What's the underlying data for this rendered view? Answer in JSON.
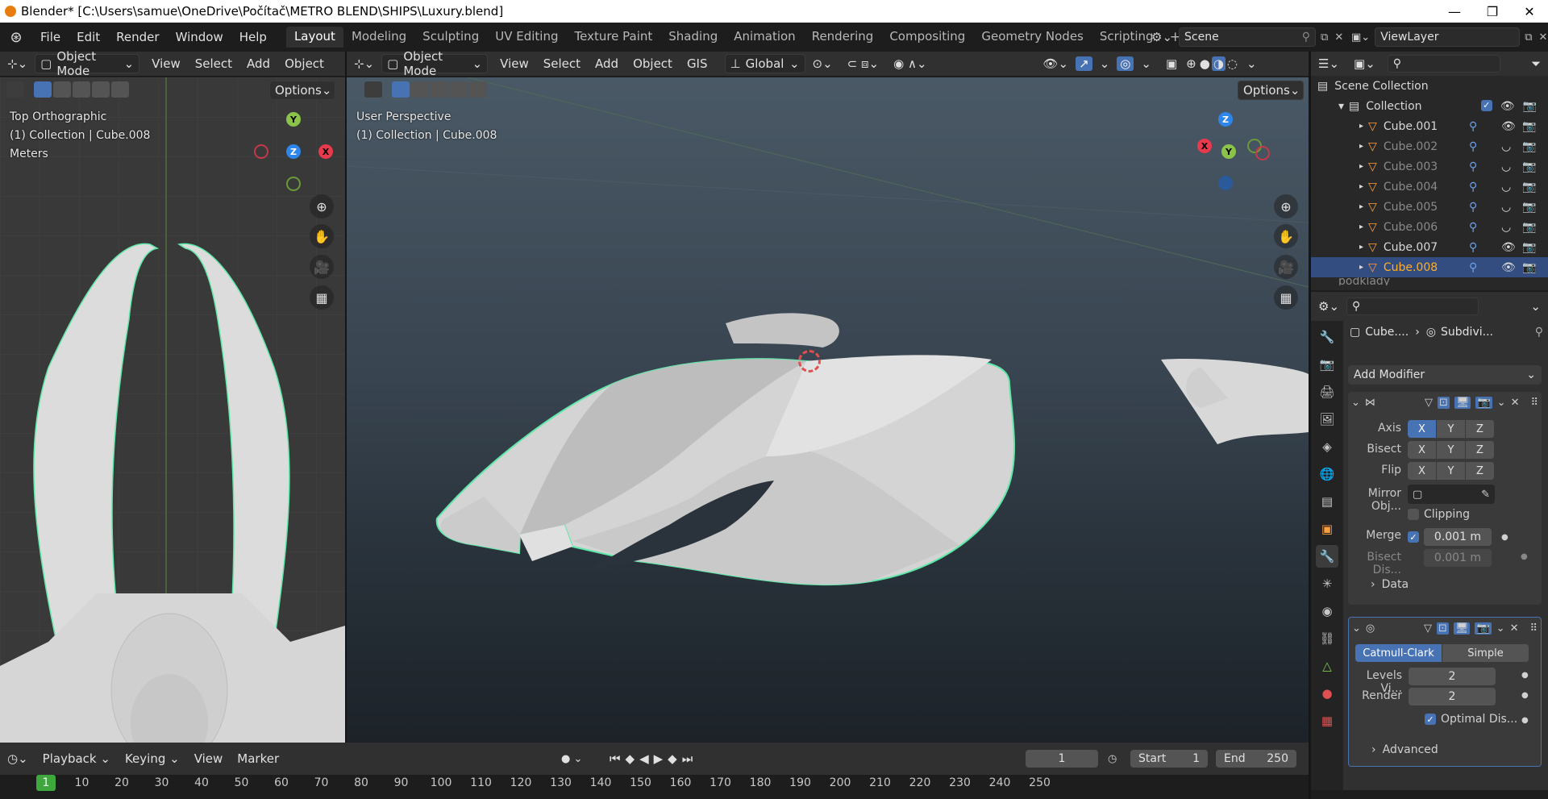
{
  "window": {
    "title": "Blender* [C:\\Users\\samue\\OneDrive\\Počítač\\METRO BLEND\\SHIPS\\Luxury.blend]",
    "minimize": "—",
    "maximize": "❐",
    "close": "✕"
  },
  "menu": [
    "File",
    "Edit",
    "Render",
    "Window",
    "Help"
  ],
  "workspaces": [
    "Layout",
    "Modeling",
    "Sculpting",
    "UV Editing",
    "Texture Paint",
    "Shading",
    "Animation",
    "Rendering",
    "Compositing",
    "Geometry Nodes",
    "Scripting"
  ],
  "active_workspace": "Layout",
  "scene": "Scene",
  "view_layer": "ViewLayer",
  "left_view": {
    "mode": "Object Mode",
    "menus": [
      "View",
      "Select",
      "Add",
      "Object"
    ],
    "options": "Options",
    "overlay": [
      "Top Orthographic",
      "(1) Collection | Cube.008",
      "Meters"
    ]
  },
  "main_view": {
    "mode": "Object Mode",
    "menus": [
      "View",
      "Select",
      "Add",
      "Object",
      "GIS"
    ],
    "transform_orientation": "Global",
    "options": "Options",
    "overlay": [
      "User Perspective",
      "(1) Collection | Cube.008"
    ]
  },
  "outliner": {
    "root": "Scene Collection",
    "collection": "Collection",
    "objects": [
      {
        "name": "Cube.001",
        "visible": true
      },
      {
        "name": "Cube.002",
        "visible": false
      },
      {
        "name": "Cube.003",
        "visible": false
      },
      {
        "name": "Cube.004",
        "visible": false
      },
      {
        "name": "Cube.005",
        "visible": false
      },
      {
        "name": "Cube.006",
        "visible": false
      },
      {
        "name": "Cube.007",
        "visible": true
      },
      {
        "name": "Cube.008",
        "visible": true,
        "selected": true
      }
    ],
    "partial_row": "podklady"
  },
  "properties": {
    "breadcrumb_object": "Cube....",
    "breadcrumb_modifier": "Subdivi...",
    "add_modifier": "Add Modifier",
    "mirror": {
      "axis_label": "Axis",
      "bisect_label": "Bisect",
      "flip_label": "Flip",
      "axes": [
        "X",
        "Y",
        "Z"
      ],
      "mirror_object_label": "Mirror Obj...",
      "clipping_label": "Clipping",
      "merge_label": "Merge",
      "merge_value": "0.001 m",
      "bisect_dist_label": "Bisect Dis...",
      "bisect_dist_value": "0.001 m",
      "data_label": "Data"
    },
    "subdivision": {
      "catmull": "Catmull-Clark",
      "simple": "Simple",
      "levels_label": "Levels Vi...",
      "levels_value": "2",
      "render_label": "Render",
      "render_value": "2",
      "optimal_label": "Optimal Dis...",
      "advanced_label": "Advanced"
    }
  },
  "timeline": {
    "menus": [
      "Playback",
      "Keying",
      "View",
      "Marker"
    ],
    "current_frame": "1",
    "start_label": "Start",
    "start_value": "1",
    "end_label": "End",
    "end_value": "250",
    "ruler": [
      "1",
      "10",
      "20",
      "30",
      "40",
      "50",
      "60",
      "70",
      "80",
      "90",
      "100",
      "110",
      "120",
      "130",
      "140",
      "150",
      "160",
      "170",
      "180",
      "190",
      "200",
      "210",
      "220",
      "230",
      "240",
      "250"
    ]
  },
  "colors": {
    "accent": "#4772b3",
    "selection_outline": "#5fe8a8",
    "header": "#303030",
    "active_object": "#ffaf29"
  }
}
